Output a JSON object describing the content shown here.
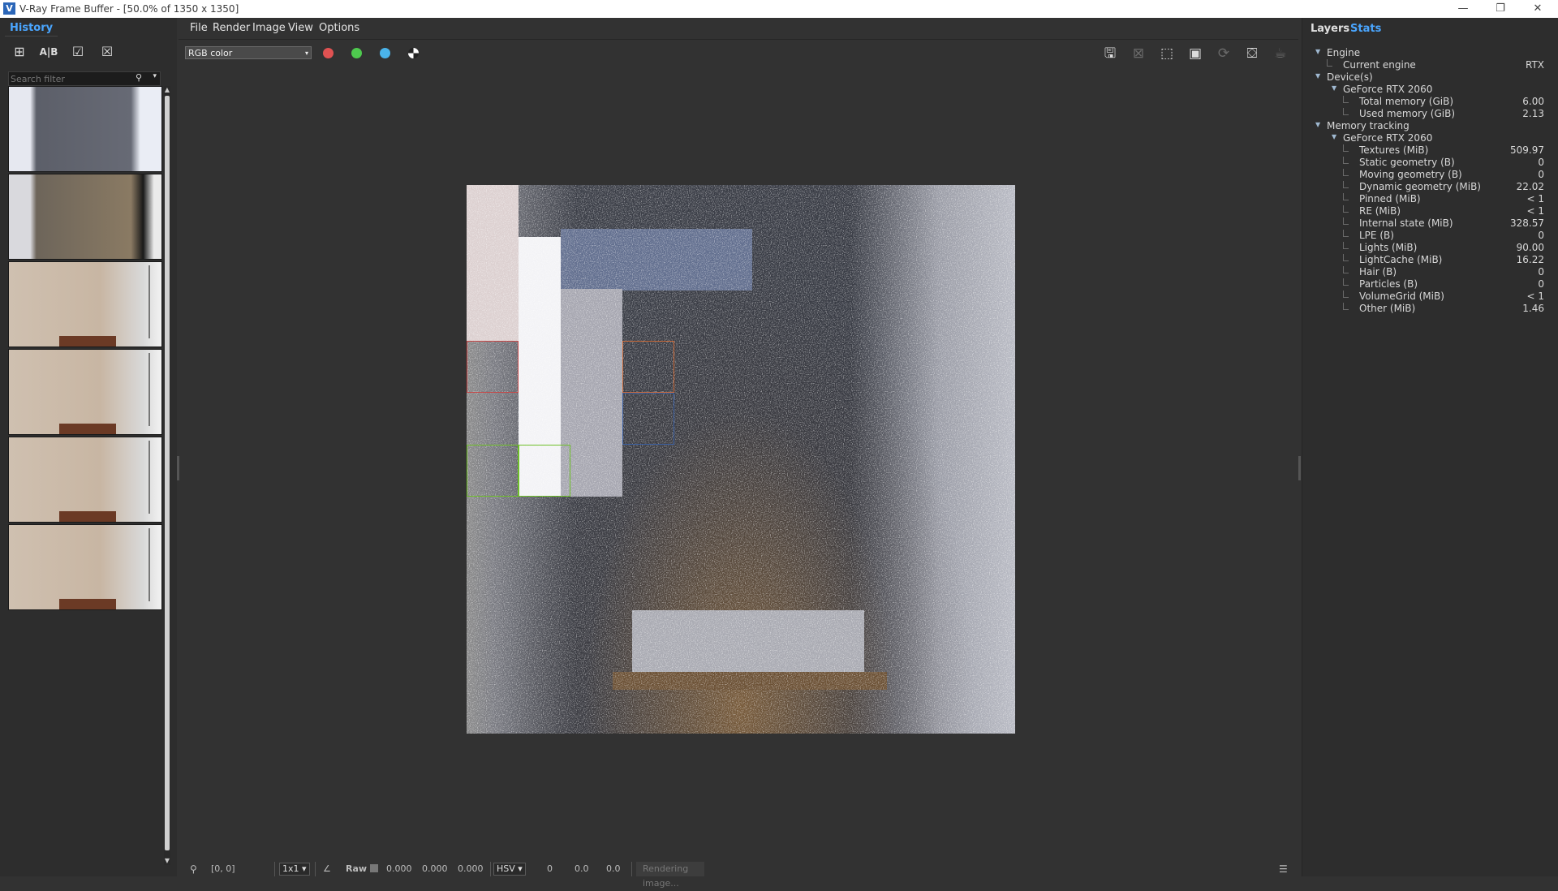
{
  "window": {
    "title": "V-Ray Frame Buffer - [50.0% of 1350 x 1350]",
    "app_icon": "V",
    "controls": {
      "minimize": "—",
      "restore": "❐",
      "close": "✕"
    }
  },
  "left_panel": {
    "tab": "History",
    "toolbar_icons": [
      "history-save-icon",
      "ab-compare-icon",
      "history-load-icon",
      "history-remove-icon"
    ],
    "search": {
      "placeholder": "Search filter",
      "value": ""
    },
    "thumbnail_count": 6
  },
  "menu": [
    "File",
    "Render",
    "Image",
    "View",
    "Options"
  ],
  "toolbar": {
    "channel": "RGB color",
    "channel_colors": {
      "red": "#e05252",
      "green": "#4ec94e",
      "blue": "#4ab3ea"
    },
    "right_icons": [
      "save-image-icon",
      "clear-image-icon",
      "region-render-icon",
      "toggle-fb-icon",
      "render-last-icon",
      "interactive-render-icon",
      "stop-render-icon"
    ]
  },
  "status": {
    "coords": "[0, 0]",
    "zoom": "1x1",
    "mode": "Raw",
    "r": "0.000",
    "g": "0.000",
    "b": "0.000",
    "colorspace": "HSV",
    "h": "0",
    "s": "0.0",
    "v": "0.0",
    "progress_text": "Rendering image..."
  },
  "right_panel": {
    "tabs": [
      "Layers",
      "Stats"
    ],
    "active_tab": "Stats",
    "tree": [
      {
        "label": "Engine",
        "value": "",
        "level": 0,
        "expandable": true
      },
      {
        "label": "Current engine",
        "value": "RTX",
        "level": 1,
        "expandable": false
      },
      {
        "label": "Device(s)",
        "value": "",
        "level": 0,
        "expandable": true
      },
      {
        "label": "GeForce RTX 2060",
        "value": "",
        "level": 1,
        "expandable": true
      },
      {
        "label": "Total memory (GiB)",
        "value": "6.00",
        "level": 2,
        "expandable": false
      },
      {
        "label": "Used memory (GiB)",
        "value": "2.13",
        "level": 2,
        "expandable": false
      },
      {
        "label": "Memory tracking",
        "value": "",
        "level": 0,
        "expandable": true
      },
      {
        "label": "GeForce RTX 2060",
        "value": "",
        "level": 1,
        "expandable": true
      },
      {
        "label": "Textures (MiB)",
        "value": "509.97",
        "level": 2,
        "expandable": false
      },
      {
        "label": "Static geometry (B)",
        "value": "0",
        "level": 2,
        "expandable": false
      },
      {
        "label": "Moving geometry (B)",
        "value": "0",
        "level": 2,
        "expandable": false
      },
      {
        "label": "Dynamic geometry (MiB)",
        "value": "22.02",
        "level": 2,
        "expandable": false
      },
      {
        "label": "Pinned (MiB)",
        "value": "< 1",
        "level": 2,
        "expandable": false
      },
      {
        "label": "RE (MiB)",
        "value": "< 1",
        "level": 2,
        "expandable": false
      },
      {
        "label": "Internal state (MiB)",
        "value": "328.57",
        "level": 2,
        "expandable": false
      },
      {
        "label": "LPE (B)",
        "value": "0",
        "level": 2,
        "expandable": false
      },
      {
        "label": "Lights (MiB)",
        "value": "90.00",
        "level": 2,
        "expandable": false
      },
      {
        "label": "LightCache (MiB)",
        "value": "16.22",
        "level": 2,
        "expandable": false
      },
      {
        "label": "Hair (B)",
        "value": "0",
        "level": 2,
        "expandable": false
      },
      {
        "label": "Particles (B)",
        "value": "0",
        "level": 2,
        "expandable": false
      },
      {
        "label": "VolumeGrid (MiB)",
        "value": "< 1",
        "level": 2,
        "expandable": false
      },
      {
        "label": "Other (MiB)",
        "value": "1.46",
        "level": 2,
        "expandable": false
      }
    ]
  },
  "colors": {
    "accent": "#4aa6ff",
    "panel_bg": "#2d2d2d",
    "viewport_bg": "#323232"
  }
}
